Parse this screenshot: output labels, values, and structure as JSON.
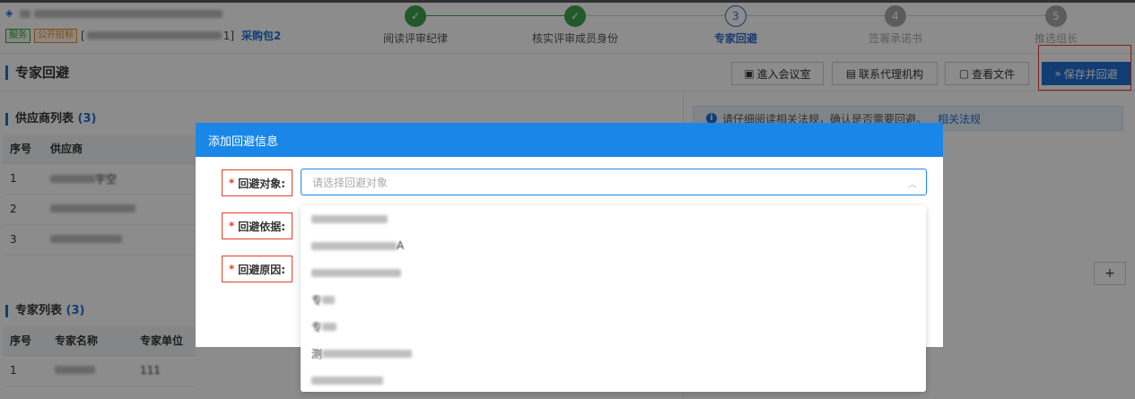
{
  "header": {
    "project_title_prefix": "",
    "tags": [
      "服务",
      "公开招标"
    ],
    "bracket_open": "[",
    "bracket_close": "1]",
    "package": "采购包2"
  },
  "steps": [
    {
      "icon": "✓",
      "label": "阅读评审纪律",
      "state": "done"
    },
    {
      "icon": "✓",
      "label": "核实评审成员身份",
      "state": "done"
    },
    {
      "icon": "3",
      "label": "专家回避",
      "state": "current"
    },
    {
      "icon": "4",
      "label": "签署承诺书",
      "state": "todo"
    },
    {
      "icon": "5",
      "label": "推选组长",
      "state": "todo"
    }
  ],
  "section": {
    "title": "专家回避",
    "buttons": {
      "meeting": "進入会议室",
      "contact": "联系代理机构",
      "files": "查看文件",
      "save": "保存并回避"
    }
  },
  "supplier_list": {
    "title": "供应商列表",
    "count": "(3)",
    "headers": [
      "序号",
      "供应商"
    ],
    "rows": [
      {
        "index": "1",
        "name_suffix": "宇空"
      },
      {
        "index": "2",
        "name_suffix": ""
      },
      {
        "index": "3",
        "name_suffix": ""
      }
    ]
  },
  "expert_list": {
    "title": "专家列表",
    "count": "(3)",
    "headers": [
      "序号",
      "专家名称",
      "专家单位"
    ],
    "rows": [
      {
        "index": "1",
        "unit": "111"
      }
    ]
  },
  "notice": {
    "text": "请仔细阅读相关法规，确认是否需要回避。",
    "link": "相关法规"
  },
  "plus_label": "+",
  "modal": {
    "title": "添加回避信息",
    "fields": {
      "target_label": "回避对象:",
      "basis_label": "回避依据:",
      "reason_label": "回避原因:"
    },
    "select_placeholder": "请选择回避对象",
    "options": [
      "",
      "A",
      "",
      "专",
      "专",
      "测",
      ""
    ]
  }
}
